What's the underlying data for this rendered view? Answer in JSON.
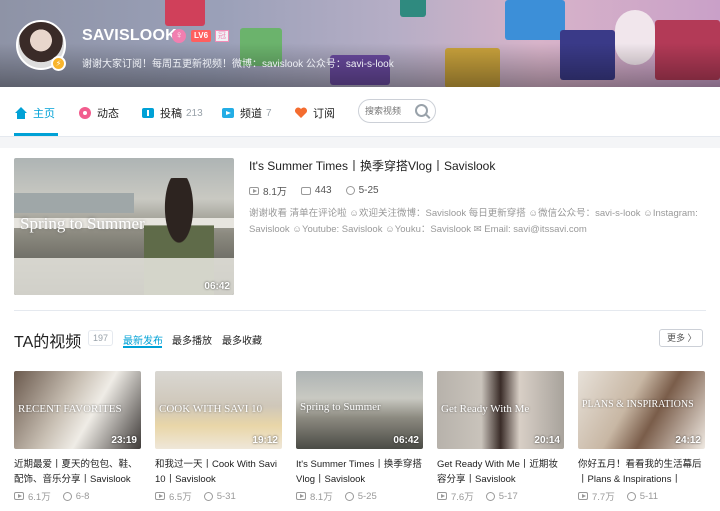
{
  "header": {
    "username": "SAVISLOOK",
    "gender_symbol": "♀",
    "level_badge": "LV6",
    "tag_badge": "冠",
    "sign": "谢谢大家订阅！每周五更新视频！微博：savislook 公众号：savi-s-look"
  },
  "nav": {
    "items": [
      {
        "label": "主页",
        "count": "",
        "icon": "home-icon",
        "color": "#00a1d6"
      },
      {
        "label": "动态",
        "count": "",
        "icon": "flower-icon",
        "color": "#f25d8e"
      },
      {
        "label": "投稿",
        "count": "213",
        "icon": "upload-icon",
        "color": "#00a1d6"
      },
      {
        "label": "频道",
        "count": "7",
        "icon": "channel-icon",
        "color": "#23ade5"
      },
      {
        "label": "订阅",
        "count": "",
        "icon": "heart-icon",
        "color": "#f46c2f"
      }
    ],
    "search_placeholder": "搜索视频"
  },
  "featured": {
    "title": "It's Summer Times丨换季穿搭Vlog丨Savislook",
    "overlay_text": "Spring to Summer",
    "duration": "06:42",
    "views": "8.1万",
    "comments": "443",
    "date": "5-25",
    "description": "谢谢收看 清单在评论啦 ☺欢迎关注微博：Savislook 每日更新穿搭 ☺微信公众号：savi-s-look ☺Instagram: Savislook ☺Youtube: Savislook ☺Youku：Savislook ✉ Email: savi@itssavi.com"
  },
  "videos_section": {
    "title": "TA的视频",
    "count": "197",
    "sort_tabs": [
      "最新发布",
      "最多播放",
      "最多收藏"
    ],
    "more_label": "更多 〉"
  },
  "videos": [
    {
      "overlay": "RECENT FAVORITES",
      "duration": "23:19",
      "title": "近期最爱丨夏天的包包、鞋、配饰、音乐分享丨Savislook",
      "views": "6.1万",
      "date": "6-8"
    },
    {
      "overlay": "COOK WITH SAVI 10",
      "duration": "19:12",
      "title": "和我过一天丨Cook With Savi 10丨Savislook",
      "views": "6.5万",
      "date": "5-31"
    },
    {
      "overlay": "Spring to Summer",
      "duration": "06:42",
      "title": "It's Summer Times丨换季穿搭Vlog丨Savislook",
      "views": "8.1万",
      "date": "5-25"
    },
    {
      "overlay": "Get Ready With Me",
      "duration": "20:14",
      "title": "Get Ready With Me丨近期妆容分享丨Savislook",
      "views": "7.6万",
      "date": "5-17"
    },
    {
      "overlay": "PLANS & INSPIRATIONS",
      "duration": "24:12",
      "title": "你好五月！看看我的生活幕后丨Plans & Inspirations丨",
      "views": "7.7万",
      "date": "5-11"
    }
  ],
  "colors": {
    "accent": "#00a1d6",
    "pink": "#f25d8e"
  }
}
